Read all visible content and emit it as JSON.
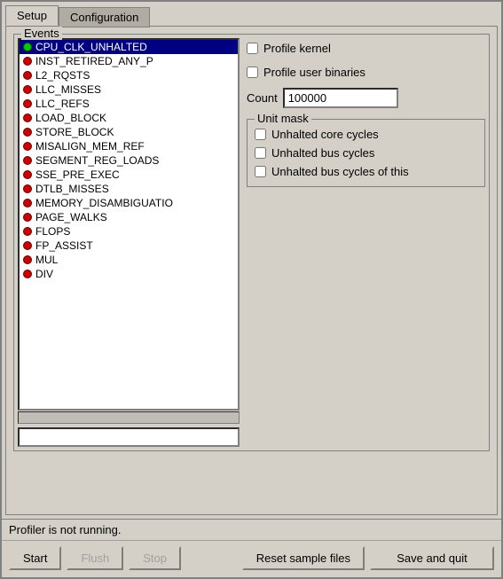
{
  "tabs": [
    {
      "id": "setup",
      "label": "Setup",
      "active": true
    },
    {
      "id": "configuration",
      "label": "Configuration",
      "active": false
    }
  ],
  "events_group": {
    "label": "Events"
  },
  "event_list": [
    {
      "id": "cpu_clk",
      "name": "CPU_CLK_UNHALTED",
      "dot": "green",
      "selected": true
    },
    {
      "id": "inst_retired",
      "name": "INST_RETIRED_ANY_P",
      "dot": "red",
      "selected": false
    },
    {
      "id": "l2_rqsts",
      "name": "L2_RQSTS",
      "dot": "red",
      "selected": false
    },
    {
      "id": "llc_misses",
      "name": "LLC_MISSES",
      "dot": "red",
      "selected": false
    },
    {
      "id": "llc_refs",
      "name": "LLC_REFS",
      "dot": "red",
      "selected": false
    },
    {
      "id": "load_block",
      "name": "LOAD_BLOCK",
      "dot": "red",
      "selected": false
    },
    {
      "id": "store_block",
      "name": "STORE_BLOCK",
      "dot": "red",
      "selected": false
    },
    {
      "id": "misalign_mem_ref",
      "name": "MISALIGN_MEM_REF",
      "dot": "red",
      "selected": false
    },
    {
      "id": "segment_reg_loads",
      "name": "SEGMENT_REG_LOADS",
      "dot": "red",
      "selected": false
    },
    {
      "id": "sse_pre_exec",
      "name": "SSE_PRE_EXEC",
      "dot": "red",
      "selected": false
    },
    {
      "id": "dtlb_misses",
      "name": "DTLB_MISSES",
      "dot": "red",
      "selected": false
    },
    {
      "id": "memory_disambig",
      "name": "MEMORY_DISAMBIGUATIO",
      "dot": "red",
      "selected": false
    },
    {
      "id": "page_walks",
      "name": "PAGE_WALKS",
      "dot": "red",
      "selected": false
    },
    {
      "id": "flops",
      "name": "FLOPS",
      "dot": "red",
      "selected": false
    },
    {
      "id": "fp_assist",
      "name": "FP_ASSIST",
      "dot": "red",
      "selected": false
    },
    {
      "id": "mul",
      "name": "MUL",
      "dot": "red",
      "selected": false
    },
    {
      "id": "div",
      "name": "DIV",
      "dot": "red",
      "selected": false
    }
  ],
  "right_panel": {
    "profile_kernel_label": "Profile kernel",
    "profile_kernel_checked": false,
    "profile_user_label": "Profile user binaries",
    "profile_user_checked": false,
    "count_label": "Count",
    "count_value": "100000",
    "unit_mask": {
      "label": "Unit mask",
      "items": [
        {
          "id": "unhalted_core",
          "label": "Unhalted core cycles",
          "checked": false
        },
        {
          "id": "unhalted_bus",
          "label": "Unhalted bus cycles",
          "checked": false
        },
        {
          "id": "unhalted_bus_this",
          "label": "Unhalted bus cycles of this",
          "checked": false
        }
      ]
    }
  },
  "status": {
    "text": "Profiler is not running."
  },
  "buttons": {
    "start": "Start",
    "flush": "Flush",
    "stop": "Stop",
    "reset": "Reset sample files",
    "save_quit": "Save and quit"
  }
}
